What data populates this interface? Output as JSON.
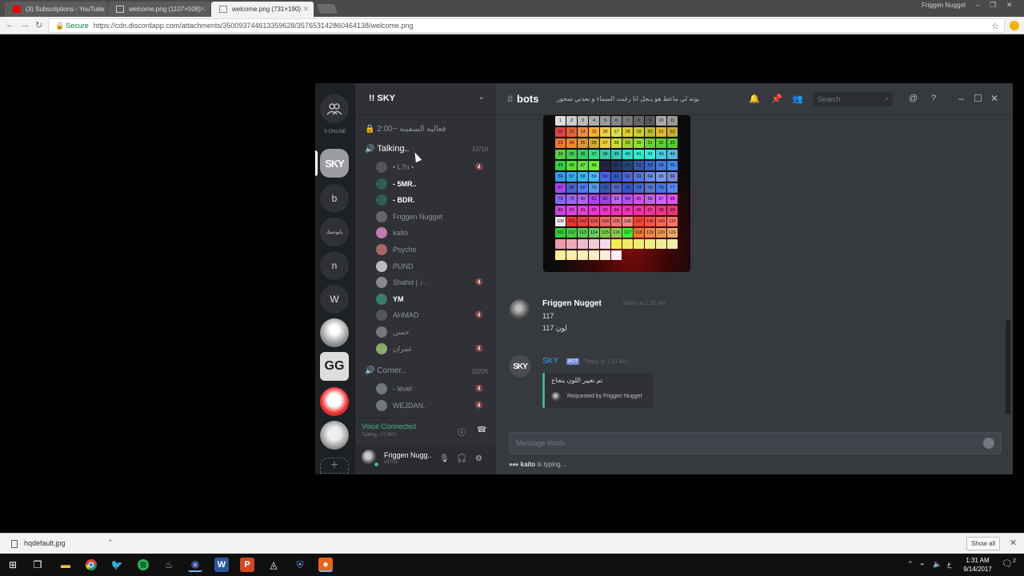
{
  "browser": {
    "tabs": [
      {
        "title": "(3) Subscriptions - YouTube"
      },
      {
        "title": "welcome.png (1107×508)"
      },
      {
        "title": "welcome.png (731×190)"
      }
    ],
    "profile_name": "Friggen Nugget",
    "address": {
      "secure_label": "Secure",
      "url": "https://cdn.discordapp.com/attachments/350093744613359628/357653142860464138/welcome.png"
    }
  },
  "discord": {
    "online_count": "5 ONLINE",
    "guilds": [
      {
        "label": "SKY"
      },
      {
        "label": "b"
      },
      {
        "label": "بابوحمك"
      },
      {
        "label": "n"
      },
      {
        "label": "W"
      },
      {
        "label": ""
      },
      {
        "label": "GG"
      },
      {
        "label": ""
      },
      {
        "label": ""
      }
    ],
    "server_name": "!! SKY",
    "channel_top": "2:00~ فعاليه السفينه",
    "voice_channel": {
      "name": "Talking..",
      "count": "12/10"
    },
    "members": [
      {
        "name": "• L7n •",
        "bright": false,
        "muted": true
      },
      {
        "name": "- 5MR..",
        "bright": true,
        "muted": false
      },
      {
        "name": "- BDR.",
        "bright": true,
        "muted": false
      },
      {
        "name": "Friggen Nugget",
        "bright": false,
        "muted": false
      },
      {
        "name": "kaito",
        "bright": false,
        "muted": false
      },
      {
        "name": "Psycho",
        "bright": false,
        "muted": false
      },
      {
        "name": "PUND",
        "bright": false,
        "muted": false
      },
      {
        "name": "Shahd | ♪ .",
        "bright": false,
        "muted": true
      },
      {
        "name": "YM",
        "bright": true,
        "muted": false
      },
      {
        "name": "AHMAD",
        "bright": false,
        "muted": true
      },
      {
        "name": "حسن",
        "bright": false,
        "muted": false
      },
      {
        "name": "عمران",
        "bright": false,
        "muted": true
      }
    ],
    "voice_channel_2": {
      "name": "Corner..",
      "count": "02/06"
    },
    "members_2": [
      {
        "name": "- level",
        "muted": true
      },
      {
        "name": "WEJDAN.",
        "muted": true
      }
    ],
    "voice_status": {
      "title": "Voice Connected",
      "sub": "Talking.. / !! SKY"
    },
    "user": {
      "name": "Friggen Nugg..",
      "tag": "#5706"
    },
    "chat": {
      "channel": "bots",
      "topic": "يونه لي ماعط هو يـجل انا رغبت السماء و بعدني سحور",
      "search_placeholder": "Search",
      "color_grid": {
        "rows": [
          [
            "1",
            "2",
            "3",
            "4",
            "5",
            "6",
            "7",
            "8",
            "9",
            "10",
            "11"
          ],
          [
            "12",
            "13",
            "14",
            "15",
            "16",
            "17",
            "18",
            "19",
            "20",
            "21",
            "22"
          ],
          [
            "23",
            "24",
            "25",
            "26",
            "27",
            "28",
            "29",
            "30",
            "31",
            "32",
            "33"
          ],
          [
            "34",
            "35",
            "36",
            "37",
            "38",
            "39",
            "40",
            "41",
            "42",
            "43",
            "44"
          ],
          [
            "45",
            "46",
            "47",
            "48",
            "49",
            "50",
            "51",
            "52",
            "53",
            "54",
            "55"
          ],
          [
            "56",
            "57",
            "58",
            "59",
            "60",
            "61",
            "62",
            "63",
            "64",
            "65",
            "66"
          ],
          [
            "67",
            "68",
            "69",
            "70",
            "71",
            "72",
            "73",
            "74",
            "75",
            "76",
            "77"
          ],
          [
            "78",
            "79",
            "80",
            "81",
            "82",
            "83",
            "84",
            "85",
            "86",
            "87",
            "88"
          ],
          [
            "89",
            "90",
            "91",
            "92",
            "93",
            "94",
            "95",
            "96",
            "97",
            "98",
            "99"
          ],
          [
            "100",
            "101",
            "102",
            "103",
            "104",
            "105",
            "106",
            "107",
            "108",
            "109",
            "110"
          ],
          [
            "111",
            "112",
            "113",
            "114",
            "115",
            "116",
            "117",
            "118",
            "119",
            "120",
            "121"
          ],
          [
            "",
            "",
            "",
            "",
            "",
            "",
            "",
            "",
            "",
            "",
            ""
          ],
          [
            "",
            "",
            "",
            "",
            "",
            "",
            "",
            "",
            "",
            "",
            ""
          ]
        ]
      },
      "messages": [
        {
          "author": "Friggen Nugget",
          "time": "Today at 1:31 AM",
          "lines": [
            "117",
            "لون 117"
          ]
        },
        {
          "author": "SKY",
          "bot_badge": "BOT",
          "time": "Today at 1:31 AM",
          "embed_title": "تم تغيير اللون بنجاح",
          "embed_footer": "Requested by Friggen Nugget"
        }
      ],
      "composer_placeholder": "Message #bots",
      "typing_user": "kaito",
      "typing_suffix": " is typing..."
    }
  },
  "downloads": {
    "file": "hqdefault.jpg",
    "show_all": "Show all"
  },
  "taskbar": {
    "time": "1:31 AM",
    "date": "9/14/2017",
    "notif_count": "2"
  },
  "colors": {
    "discord_blurple": "#7289da",
    "online_green": "#43b581",
    "bot_blue": "#3ba1e0"
  }
}
